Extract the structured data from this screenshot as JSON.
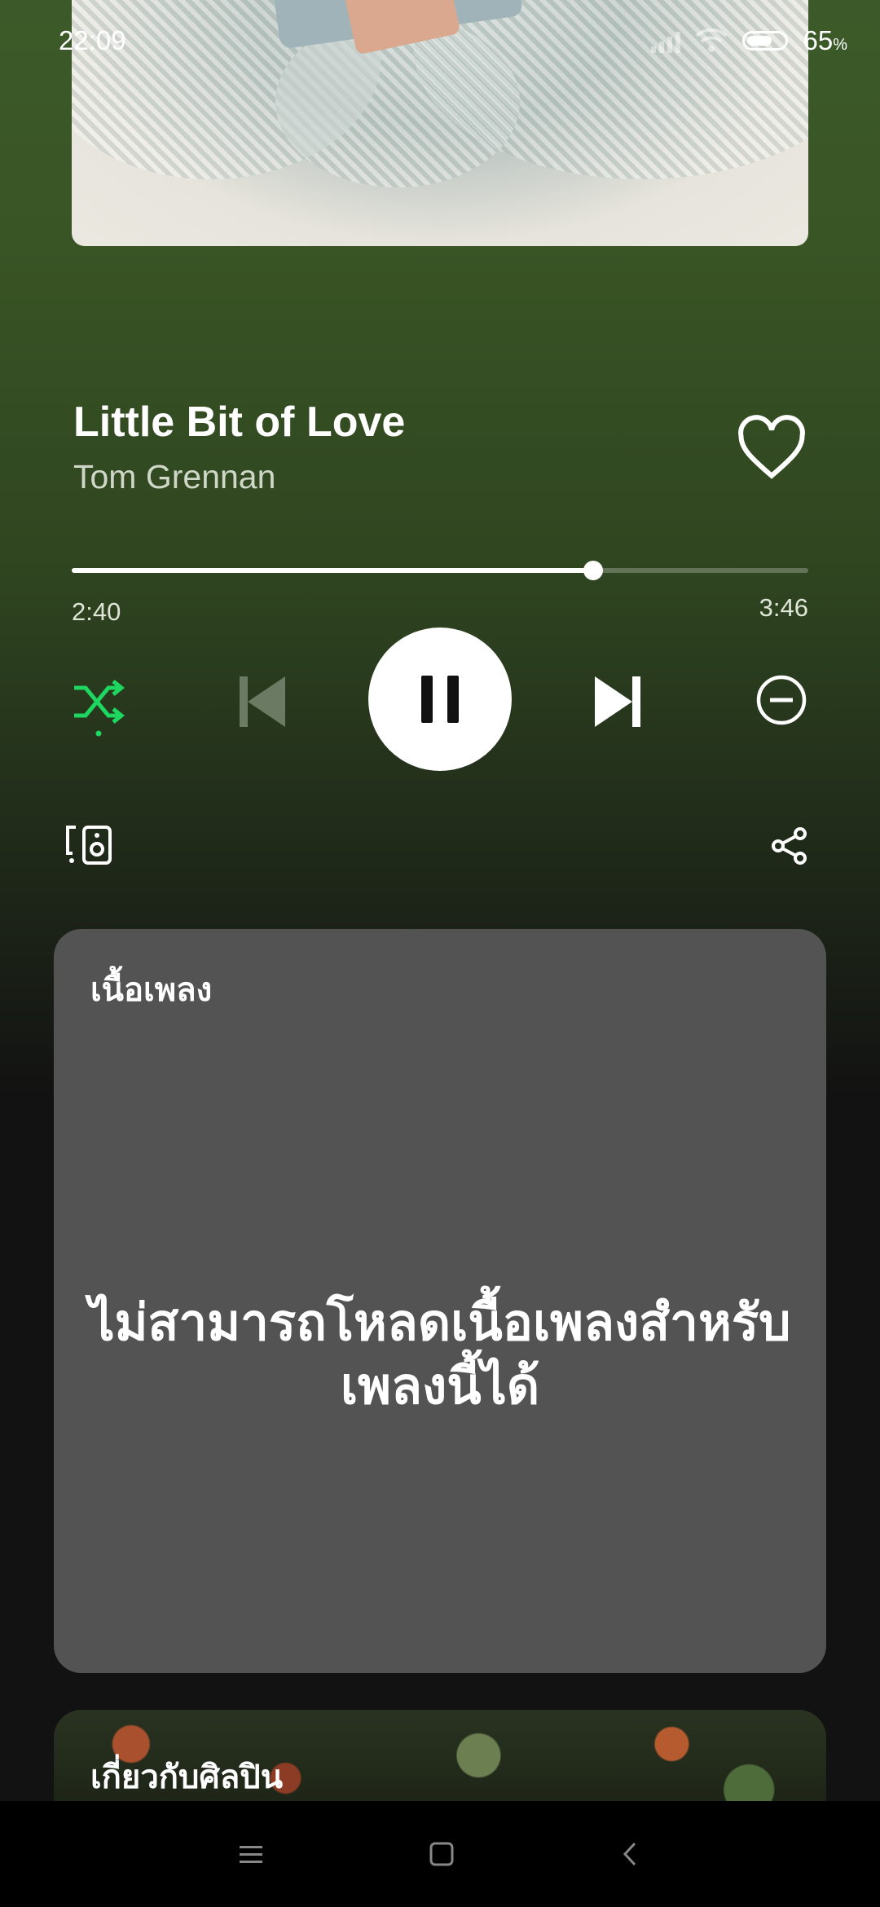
{
  "status_bar": {
    "time": "22:09",
    "battery": "65"
  },
  "track": {
    "title": "Little Bit of Love",
    "artist": "Tom Grennan"
  },
  "playback": {
    "elapsed": "2:40",
    "duration": "3:46",
    "progress_fraction": 0.708
  },
  "colors": {
    "accent": "#1ed760",
    "lyrics_card": "#535353"
  },
  "lyrics": {
    "heading": "เนื้อเพลง",
    "message": "ไม่สามารถโหลดเนื้อเพลงสำหรับเพลงนี้ได้"
  },
  "about_artist": {
    "heading": "เกี่ยวกับศิลปิน"
  }
}
